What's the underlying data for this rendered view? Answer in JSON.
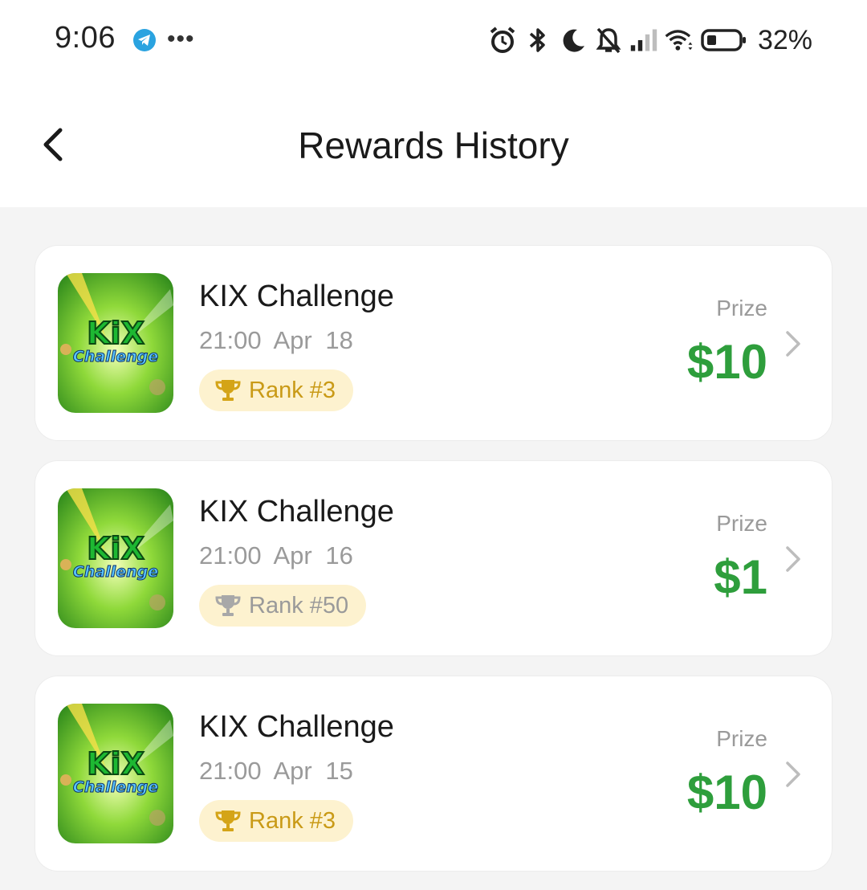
{
  "status_bar": {
    "time": "9:06",
    "battery": "32%",
    "icons": [
      "telegram-icon",
      "more-dots-icon",
      "alarm-icon",
      "bluetooth-icon",
      "do-not-disturb-moon-icon",
      "bell-off-icon",
      "signal-icon",
      "wifi-icon",
      "battery-icon"
    ]
  },
  "header": {
    "title": "Rewards History",
    "back_icon": "chevron-left-icon"
  },
  "colors": {
    "prize_green": "#2e9e3c",
    "badge_bg": "#fdf2cf",
    "rank_gold": "#c99a16",
    "rank_silver": "#9a9a9a"
  },
  "rewards": [
    {
      "title": "KIX Challenge",
      "time": "21:00  Apr 18",
      "rank": "Rank #3",
      "rank_tier": "gold",
      "prize_label": "Prize",
      "prize": "$10",
      "logo_text_1": "KiX",
      "logo_text_2": "Challenge"
    },
    {
      "title": "KIX Challenge",
      "time": "21:00  Apr 16",
      "rank": "Rank #50",
      "rank_tier": "silver",
      "prize_label": "Prize",
      "prize": "$1",
      "logo_text_1": "KiX",
      "logo_text_2": "Challenge"
    },
    {
      "title": "KIX Challenge",
      "time": "21:00  Apr 15",
      "rank": "Rank #3",
      "rank_tier": "gold",
      "prize_label": "Prize",
      "prize": "$10",
      "logo_text_1": "KiX",
      "logo_text_2": "Challenge"
    }
  ]
}
